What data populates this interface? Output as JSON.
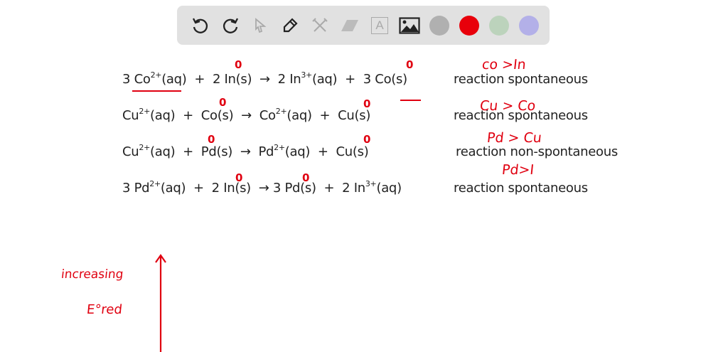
{
  "toolbar": {
    "tools": [
      {
        "name": "undo-icon",
        "enabled": true
      },
      {
        "name": "redo-icon",
        "enabled": true
      },
      {
        "name": "select-icon",
        "enabled": false
      },
      {
        "name": "pen-icon",
        "enabled": true
      },
      {
        "name": "tools-icon",
        "enabled": false
      },
      {
        "name": "eraser-icon",
        "enabled": false
      },
      {
        "name": "text-icon",
        "enabled": false,
        "label": "A"
      },
      {
        "name": "image-icon",
        "enabled": true
      }
    ],
    "colors": [
      "#b0b0b0",
      "#e8000b",
      "#bcd3bc",
      "#b3b0e8"
    ]
  },
  "equations": [
    {
      "tokens": [
        [
          "3 Co",
          "2+"
        ],
        [
          "(aq)  +  2 In(s)  →  2 In",
          ""
        ],
        [
          "",
          "3+"
        ],
        [
          "(aq)  +  3 Co(s)",
          ""
        ]
      ],
      "result": "reaction spontaneous"
    },
    {
      "tokens": [
        [
          "Cu",
          "2+"
        ],
        [
          "(aq)  +  Co(s)  →  Co",
          ""
        ],
        [
          "",
          "2+"
        ],
        [
          "(aq)  +  Cu(s)",
          ""
        ]
      ],
      "result": "reaction spontaneous"
    },
    {
      "tokens": [
        [
          "Cu",
          "2+"
        ],
        [
          "(aq)  +  Pd(s)  →  Pd",
          ""
        ],
        [
          "",
          "2+"
        ],
        [
          "(aq)  +  Cu(s)",
          ""
        ]
      ],
      "result": "reaction non-spontaneous"
    },
    {
      "tokens": [
        [
          "3 Pd",
          "2+"
        ],
        [
          "(aq)  +  2 In(s)  → 3 Pd(s)  +  2 In",
          ""
        ],
        [
          "",
          "3+"
        ],
        [
          "(aq)",
          ""
        ]
      ],
      "result": "reaction spontaneous"
    }
  ],
  "annotations": {
    "a1": "co >In",
    "a2": "Cu > Co",
    "a3": "Pd > Cu",
    "a4": "Pd>I",
    "inc": "increasing",
    "ered": "E°red",
    "zero": "0"
  }
}
